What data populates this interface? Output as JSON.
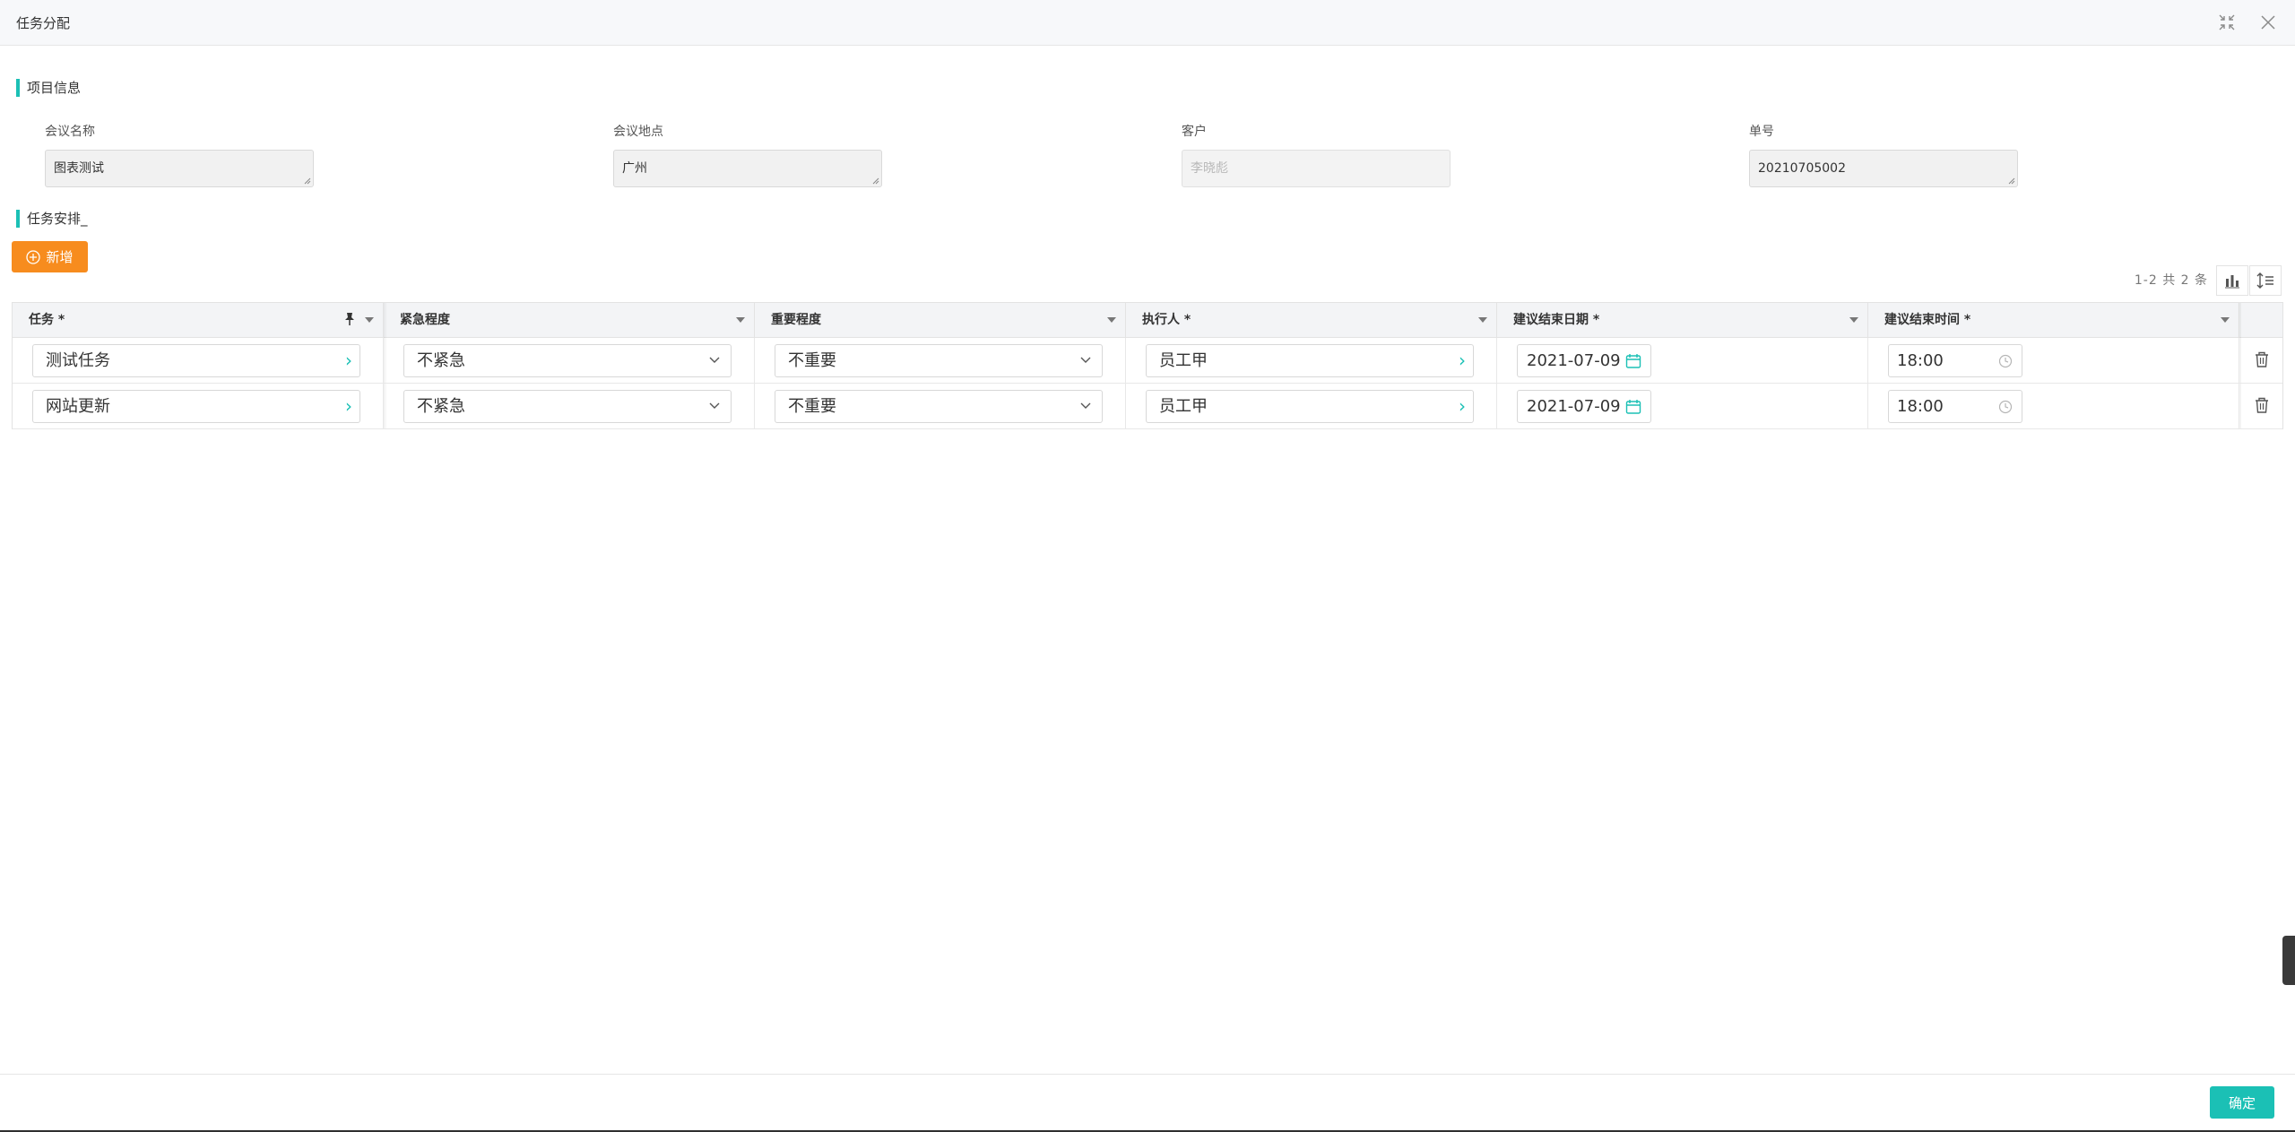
{
  "dialog": {
    "title": "任务分配",
    "ok_label": "确定"
  },
  "project_info": {
    "section_title": "项目信息",
    "fields": [
      {
        "label": "会议名称",
        "value": "图表测试"
      },
      {
        "label": "会议地点",
        "value": "广州"
      },
      {
        "label": "客户",
        "value": "李晓彪"
      },
      {
        "label": "单号",
        "value": "20210705002"
      }
    ]
  },
  "tasks": {
    "section_title": "任务安排_",
    "add_label": "新增",
    "pager_info": "1-2 共 2 条",
    "columns": [
      {
        "label": "任务 *"
      },
      {
        "label": "紧急程度"
      },
      {
        "label": "重要程度"
      },
      {
        "label": "执行人 *"
      },
      {
        "label": "建议结束日期 *"
      },
      {
        "label": "建议结束时间 *"
      }
    ],
    "rows": [
      {
        "task": "测试任务",
        "urgency": "不紧急",
        "importance": "不重要",
        "assignee": "员工甲",
        "end_date": "2021-07-09",
        "end_time": "18:00"
      },
      {
        "task": "网站更新",
        "urgency": "不紧急",
        "importance": "不重要",
        "assignee": "员工甲",
        "end_date": "2021-07-09",
        "end_time": "18:00"
      }
    ]
  },
  "colors": {
    "accent": "#1bc0b5",
    "add_button": "#f78c1e"
  }
}
